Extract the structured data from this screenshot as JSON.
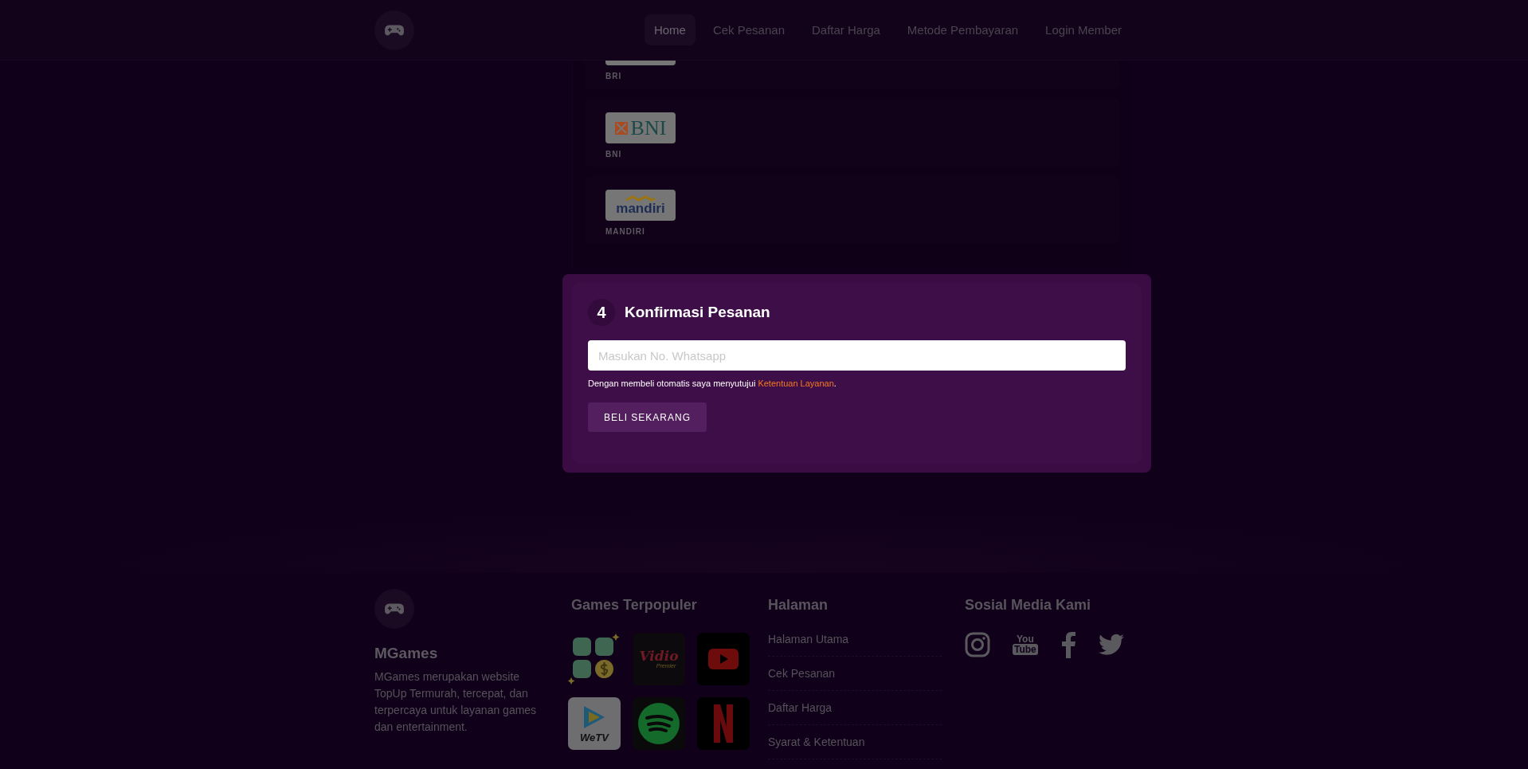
{
  "header": {
    "nav": [
      {
        "label": "Home",
        "selected": true
      },
      {
        "label": "Cek Pesanan",
        "selected": false
      },
      {
        "label": "Daftar Harga",
        "selected": false
      },
      {
        "label": "Metode Pembayaran",
        "selected": false
      },
      {
        "label": "Login Member",
        "selected": false
      }
    ]
  },
  "payment_methods": [
    {
      "kind": "bri",
      "name": "BRI"
    },
    {
      "kind": "bni",
      "name": "BNI",
      "logo_text": "BNI"
    },
    {
      "kind": "mandiri",
      "name": "MANDIRI",
      "logo_text": "mandiri"
    }
  ],
  "confirmation": {
    "step": "4",
    "title": "Konfirmasi Pesanan",
    "whatsapp_field": {
      "placeholder": "Masukan No. Whatsapp"
    },
    "terms": "Dengan membeli otomatis saya menyutujui",
    "terms_link": "Ketentuan Layanan",
    "terms_end": ".",
    "button": "BELI SEKARANG"
  },
  "footer": {
    "brand": "MGames",
    "description": "MGames merupakan website TopUp Termurah, tercepat, dan terpercaya untuk layanan games dan entertainment.",
    "games_title": "Games Terpopuler",
    "games": [
      {
        "kind": "apps-coin"
      },
      {
        "kind": "vidio",
        "text": "Vidio",
        "subtext": "Premier"
      },
      {
        "kind": "youtube"
      },
      {
        "kind": "wetv",
        "text": "WeTV"
      },
      {
        "kind": "spotify"
      },
      {
        "kind": "netflix"
      }
    ],
    "pages_title": "Halaman",
    "pages": [
      "Halaman Utama",
      "Cek Pesanan",
      "Daftar Harga",
      "Syarat & Ketentuan"
    ],
    "social_title": "Sosial Media Kami",
    "social": [
      {
        "kind": "instagram"
      },
      {
        "kind": "youtube",
        "text": "You",
        "subtext": "Tube"
      },
      {
        "kind": "facebook"
      },
      {
        "kind": "twitter"
      }
    ]
  }
}
